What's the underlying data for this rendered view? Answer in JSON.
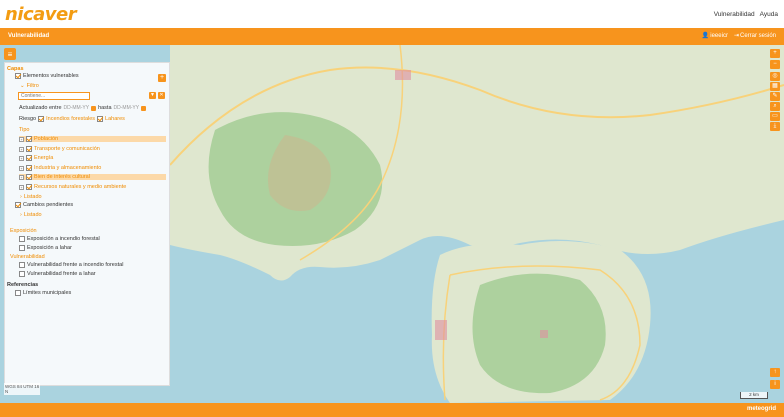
{
  "app": {
    "logo": "nicaver",
    "links": [
      "Vulnerabilidad",
      "Ayuda"
    ]
  },
  "bar": {
    "title": "Vulnerabilidad",
    "user": "ieeeicr",
    "logout": "Cerrar sesión"
  },
  "panel": {
    "capas": "Capas",
    "elementos": "Elementos vulnerables",
    "filtro": "Filtro",
    "contiene_placeholder": "Contiene...",
    "actualizado": "Actualizado entre",
    "date_from": "DD-MM-YY",
    "hasta": "hasta",
    "date_to": "DD-MM-YY",
    "riesgo": "Riesgo",
    "incendios": "Incendios forestales",
    "lahares": "Lahares",
    "tipo": "Tipo",
    "tipos": [
      "Población",
      "Transporte y comunicación",
      "Energía",
      "Industria y almacenamiento",
      "Bien de interés cultural",
      "Recursos naturales y medio ambiente"
    ],
    "listado1": "Listado",
    "cambios": "Cambios pendientes",
    "listado2": "Listado",
    "exposicion": "Exposición",
    "exp_items": [
      "Exposición a incendio forestal",
      "Exposición a lahar"
    ],
    "vulnerabilidad": "Vulnerabilidad",
    "vul_items": [
      "Vulnerabilidad frente a incendio forestal",
      "Vulnerabilidad frente a lahar"
    ],
    "referencias": "Referencias",
    "ref_items": [
      "Límites municipales"
    ]
  },
  "coords": {
    "sys": "WGS 84 UTM 16",
    "dir": "N"
  },
  "scale": "2 km",
  "brand": "meteogrid"
}
